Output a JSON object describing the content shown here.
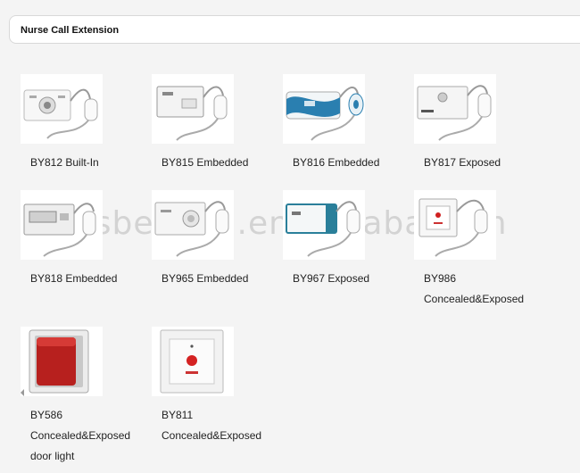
{
  "header": {
    "title": "Nurse Call Extension"
  },
  "watermark": "csbeyond.en.alibaba.com",
  "products": [
    {
      "icon": "wall-station-grille-handset-icon",
      "lines": [
        "BY812 Built-In"
      ]
    },
    {
      "icon": "wall-station-handset-icon",
      "lines": [
        "BY815 Embedded"
      ]
    },
    {
      "icon": "wall-station-blue-handset-icon",
      "lines": [
        "BY816 Embedded"
      ]
    },
    {
      "icon": "wall-station-speaker-handset-icon",
      "lines": [
        "BY817 Exposed"
      ]
    },
    {
      "icon": "wall-station-display-handset-icon",
      "lines": [
        "BY818 Embedded"
      ]
    },
    {
      "icon": "wall-station-round-speaker-handset-icon",
      "lines": [
        "BY965 Embedded"
      ]
    },
    {
      "icon": "wall-station-teal-handset-icon",
      "lines": [
        "BY967 Exposed"
      ]
    },
    {
      "icon": "call-button-handset-icon",
      "lines": [
        "BY986",
        "Concealed&Exposed"
      ]
    },
    {
      "icon": "red-door-light-icon",
      "lines": [
        "BY586",
        "Concealed&Exposed",
        "door light"
      ]
    },
    {
      "icon": "red-call-button-icon",
      "lines": [
        "BY811",
        "Concealed&Exposed"
      ]
    }
  ]
}
